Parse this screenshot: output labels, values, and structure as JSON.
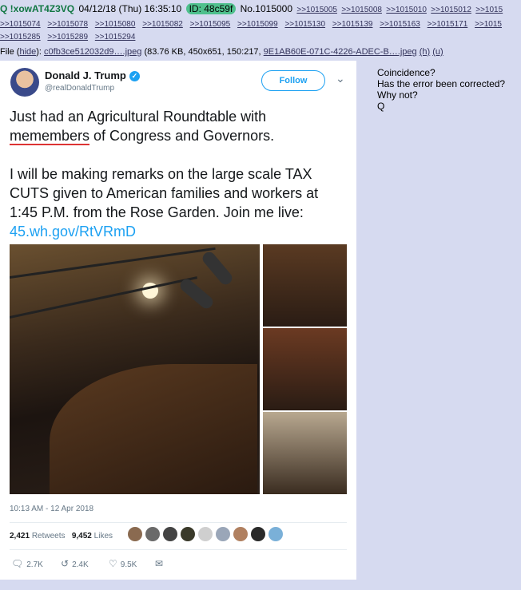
{
  "post": {
    "trip": "Q !xowAT4Z3VQ",
    "date": "04/12/18 (Thu) 16:35:10",
    "id_label": "ID: 48c59f",
    "number": "No.1015000",
    "backlinks_row1": [
      ">>1015005",
      ">>1015008",
      ">>1015010",
      ">>1015012",
      ">>1015"
    ],
    "backlinks_row2": [
      ">>1015074",
      ">>1015078",
      ">>1015080",
      ">>1015082",
      ">>1015095",
      ">>1015099",
      ">>1015130",
      ">>1015139",
      ">>1015163",
      ">>1015171",
      ">>1015"
    ],
    "backlinks_row3": [
      ">>1015285",
      ">>1015289",
      ">>1015294"
    ],
    "file": {
      "prefix": "File (",
      "hide": "hide",
      "suffix": "):",
      "name": "c0fb3ce512032d9….jpeg",
      "meta": "(83.76 KB, 450x651, 150:217,",
      "original": "9E1AB60E-071C-4226-ADEC-B….jpeg",
      "h": "(h)",
      "u": "(u)"
    },
    "message": [
      "Coincidence?",
      "Has the error been corrected?",
      "Why not?",
      "Q"
    ]
  },
  "tweet": {
    "name": "Donald J. Trump",
    "handle": "@realDonaldTrump",
    "follow_label": "Follow",
    "chevron_icon": "chevron-down-icon",
    "line1_prefix": "Just had an Agricultural Roundtable with ",
    "typo": "memembers",
    "line1_suffix": " of Congress and Governors.",
    "line2": "I will be making remarks on the large scale TAX CUTS given to American families and workers at 1:45 P.M. from the Rose Garden. Join me live: ",
    "link": "45.wh.gov/RtVRmD",
    "timestamp": "10:13 AM - 12 Apr 2018",
    "retweets_count": "2,421",
    "retweets_label": "Retweets",
    "likes_count": "9,452",
    "likes_label": "Likes",
    "reply_count": "2.7K",
    "retweet_count": "2.4K",
    "like_count": "9.5K"
  },
  "colors": {
    "background": "#d6daf0",
    "trip": "#117743",
    "id_badge": "#4fc08d",
    "twitter_blue": "#1da1f2"
  }
}
